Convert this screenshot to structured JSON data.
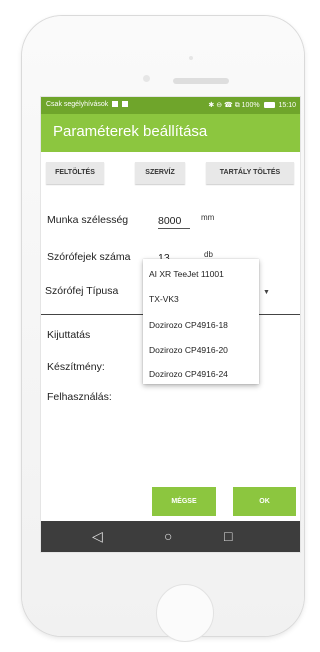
{
  "status_bar": {
    "carrier": "Csak segélyhívások",
    "status_icons": "✱ ⊖ ☎ ⧉",
    "battery": "100%",
    "time": "15:10"
  },
  "app_bar": {
    "title": "Paraméterek beállítása"
  },
  "toolbar": {
    "buttons": [
      "FELTÖLTÉS",
      "SZERVÍZ",
      "TARTÁLY TÖLTÉS"
    ]
  },
  "form": {
    "work_width": {
      "label": "Munka szélesség",
      "value": "8000",
      "unit": "mm"
    },
    "nozzle_count": {
      "label": "Szórófejek száma",
      "value": "13",
      "unit": "db"
    },
    "nozzle_type": {
      "label": "Szórófej Típusa",
      "options": [
        "AI XR TeeJet 11001",
        "TX-VK3",
        "Dozirozo CP4916-18",
        "Dozirozo CP4916-20",
        "Dozirozo CP4916-24"
      ]
    }
  },
  "info": {
    "application": "Kijuttatás",
    "product": "Készítmény:",
    "usage": "Felhasználás:"
  },
  "actions": {
    "cancel": "MÉGSE",
    "ok": "OK"
  },
  "nav": {
    "back_icon": "back-icon",
    "home_icon": "home-icon",
    "recents_icon": "recents-icon"
  },
  "colors": {
    "primary": "#8cc63f",
    "status_bar": "#6fa52b",
    "nav_bar": "#3d3d3d"
  }
}
